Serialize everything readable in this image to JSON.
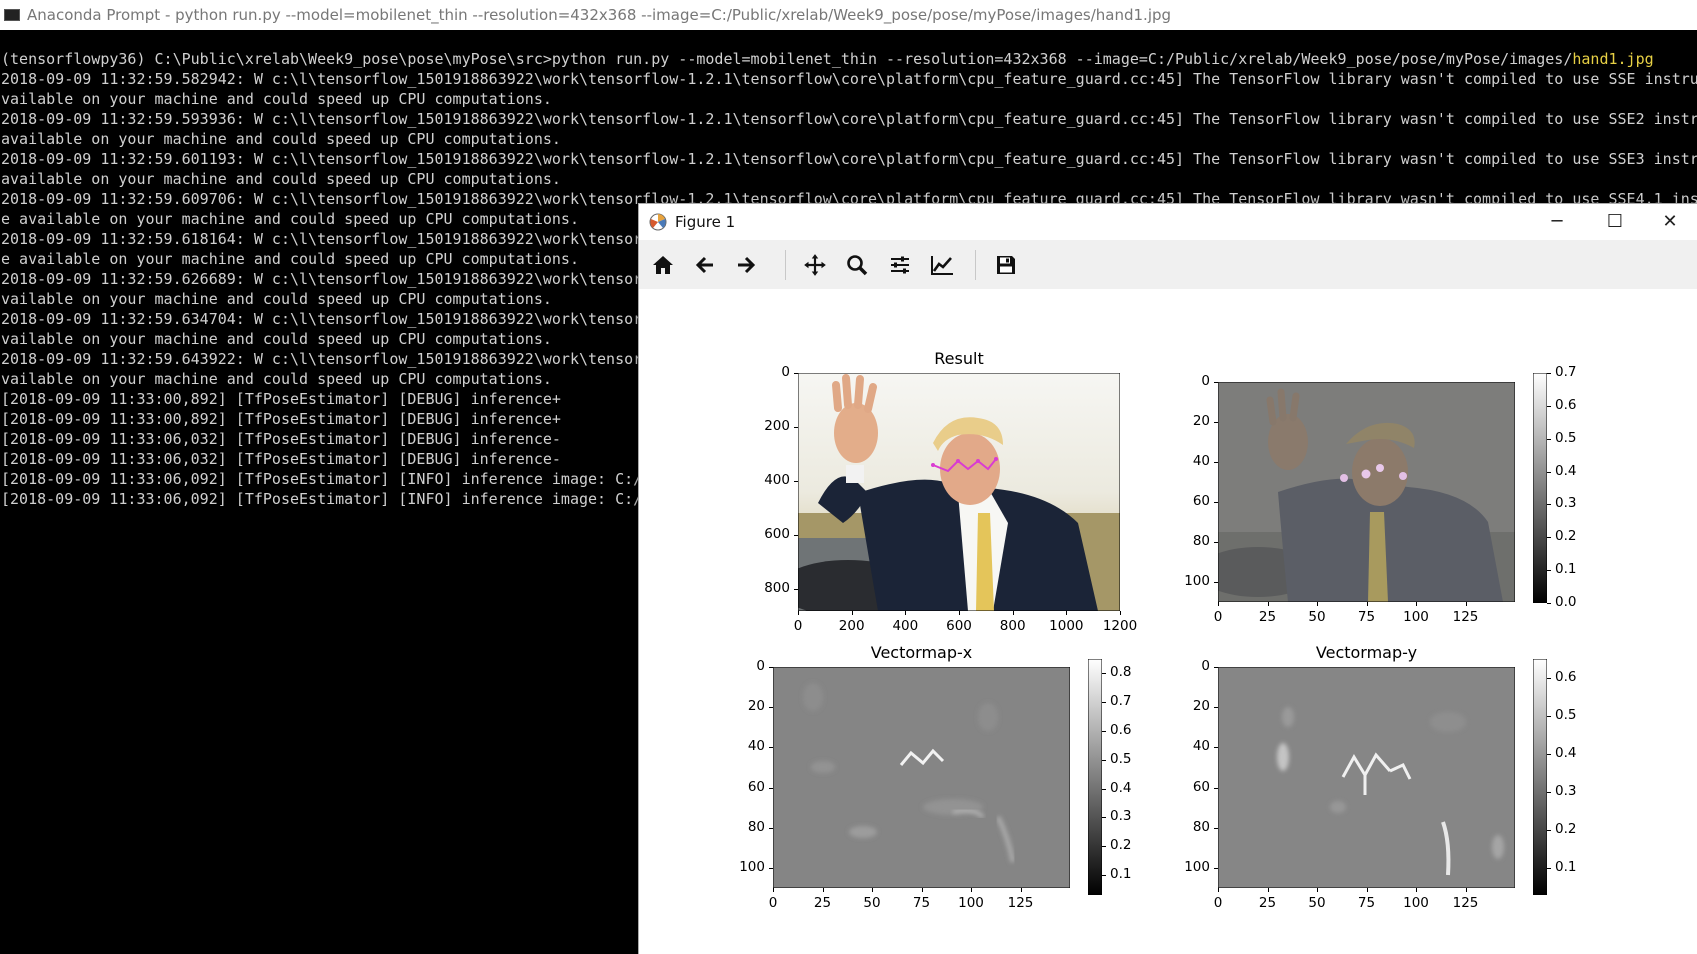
{
  "console": {
    "title": "Anaconda Prompt - python  run.py --model=mobilenet_thin --resolution=432x368 --image=C:/Public/xrelab/Week9_pose/pose/myPose/images/hand1.jpg",
    "lines": [
      "(tensorflowpy36) C:\\Public\\xrelab\\Week9_pose\\pose\\myPose\\src>python run.py --model=mobilenet_thin --resolution=432x368 --image=C:/Public/xrelab/Week9_pose/pose/myPose/images/",
      "2018-09-09 11:32:59.582942: W c:\\l\\tensorflow_1501918863922\\work\\tensorflow-1.2.1\\tensorflow\\core\\platform\\cpu_feature_guard.cc:45] The TensorFlow library wasn't compiled to use SSE instru",
      "vailable on your machine and could speed up CPU computations.",
      "2018-09-09 11:32:59.593936: W c:\\l\\tensorflow_1501918863922\\work\\tensorflow-1.2.1\\tensorflow\\core\\platform\\cpu_feature_guard.cc:45] The TensorFlow library wasn't compiled to use SSE2 instru",
      "available on your machine and could speed up CPU computations.",
      "2018-09-09 11:32:59.601193: W c:\\l\\tensorflow_1501918863922\\work\\tensorflow-1.2.1\\tensorflow\\core\\platform\\cpu_feature_guard.cc:45] The TensorFlow library wasn't compiled to use SSE3 instru",
      "available on your machine and could speed up CPU computations.",
      "2018-09-09 11:32:59.609706: W c:\\l\\tensorflow_1501918863922\\work\\tensorflow-1.2.1\\tensorflow\\core\\platform\\cpu_feature_guard.cc:45] The TensorFlow library wasn't compiled to use SSE4.1 inst",
      "e available on your machine and could speed up CPU computations.",
      "2018-09-09 11:32:59.618164: W c:\\l\\tensorflow_1501918863922\\work\\tensor",
      "e available on your machine and could speed up CPU computations.",
      "2018-09-09 11:32:59.626689: W c:\\l\\tensorflow_1501918863922\\work\\tensor",
      "vailable on your machine and could speed up CPU computations.",
      "2018-09-09 11:32:59.634704: W c:\\l\\tensorflow_1501918863922\\work\\tensor",
      "vailable on your machine and could speed up CPU computations.",
      "2018-09-09 11:32:59.643922: W c:\\l\\tensorflow_1501918863922\\work\\tensor",
      "vailable on your machine and could speed up CPU computations.",
      "[2018-09-09 11:33:00,892] [TfPoseEstimator] [DEBUG] inference+",
      "[2018-09-09 11:33:00,892] [TfPoseEstimator] [DEBUG] inference+",
      "[2018-09-09 11:33:06,032] [TfPoseEstimator] [DEBUG] inference-",
      "[2018-09-09 11:33:06,032] [TfPoseEstimator] [DEBUG] inference-",
      "[2018-09-09 11:33:06,092] [TfPoseEstimator] [INFO] inference image: C:/",
      "[2018-09-09 11:33:06,092] [TfPoseEstimator] [INFO] inference image: C:/"
    ],
    "highlight": "hand1.jpg"
  },
  "figure": {
    "title": "Figure 1",
    "window_buttons": {
      "minimize": "─",
      "maximize": "☐",
      "close": "✕"
    },
    "toolbar": [
      "home-icon",
      "back-arrow-icon",
      "forward-arrow-icon",
      "pan-icon",
      "zoom-icon",
      "subplots-config-icon",
      "edit-axis-icon",
      "save-icon"
    ]
  },
  "chart_data": [
    {
      "type": "heatmap",
      "title": "Result",
      "xticks": [
        "0",
        "200",
        "400",
        "600",
        "800",
        "1000",
        "1200"
      ],
      "yticks": [
        "0",
        "200",
        "400",
        "600",
        "800"
      ],
      "xlim": [
        0,
        1200
      ],
      "ylim": [
        880,
        0
      ]
    },
    {
      "type": "heatmap",
      "title": "",
      "xticks": [
        "0",
        "25",
        "50",
        "75",
        "100",
        "125"
      ],
      "yticks": [
        "0",
        "20",
        "40",
        "60",
        "80",
        "100"
      ],
      "xlim": [
        0,
        150
      ],
      "ylim": [
        110,
        0
      ],
      "colorbar_ticks": [
        "0.0",
        "0.1",
        "0.2",
        "0.3",
        "0.4",
        "0.5",
        "0.6",
        "0.7"
      ],
      "colorbar_range": [
        0,
        0.7
      ]
    },
    {
      "type": "heatmap",
      "title": "Vectormap-x",
      "xticks": [
        "0",
        "25",
        "50",
        "75",
        "100",
        "125"
      ],
      "yticks": [
        "0",
        "20",
        "40",
        "60",
        "80",
        "100"
      ],
      "xlim": [
        0,
        150
      ],
      "ylim": [
        110,
        0
      ],
      "colorbar_ticks": [
        "0.1",
        "0.2",
        "0.3",
        "0.4",
        "0.5",
        "0.6",
        "0.7",
        "0.8"
      ],
      "colorbar_range": [
        0.03,
        0.85
      ]
    },
    {
      "type": "heatmap",
      "title": "Vectormap-y",
      "xticks": [
        "0",
        "25",
        "50",
        "75",
        "100",
        "125"
      ],
      "yticks": [
        "0",
        "20",
        "40",
        "60",
        "80",
        "100"
      ],
      "xlim": [
        0,
        150
      ],
      "ylim": [
        110,
        0
      ],
      "colorbar_ticks": [
        "0.1",
        "0.2",
        "0.3",
        "0.4",
        "0.5",
        "0.6"
      ],
      "colorbar_range": [
        0.03,
        0.65
      ]
    }
  ]
}
